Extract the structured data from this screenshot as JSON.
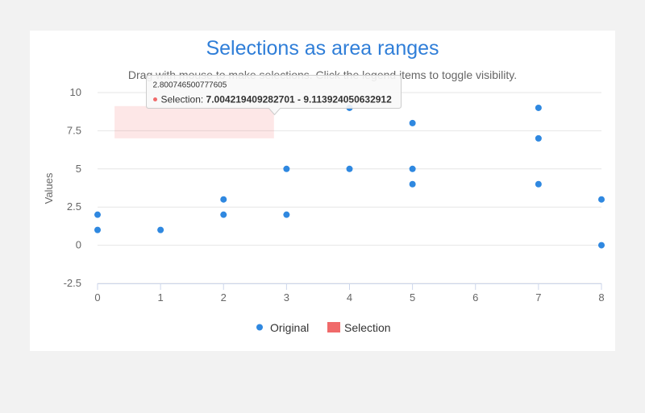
{
  "chart_data": {
    "type": "scatter",
    "title": "Selections as area ranges",
    "subtitle": "Drag with mouse to make selections. Click the legend items to toggle visibility.",
    "ylabel": "Values",
    "xlabel": "",
    "xlim": [
      0,
      8
    ],
    "ylim": [
      -2.5,
      10
    ],
    "x_ticks": [
      "0",
      "1",
      "2",
      "3",
      "4",
      "5",
      "6",
      "7",
      "8"
    ],
    "y_ticks": [
      "-2.5",
      "0",
      "2.5",
      "5",
      "7.5",
      "10"
    ],
    "grid": "horizontal",
    "legend_position": "bottom",
    "series": [
      {
        "name": "Original",
        "type": "scatter",
        "color": "#2f88e0",
        "points": [
          [
            0,
            1
          ],
          [
            0,
            2
          ],
          [
            1,
            1
          ],
          [
            2,
            2
          ],
          [
            2,
            3
          ],
          [
            3,
            2
          ],
          [
            3,
            5
          ],
          [
            4,
            5
          ],
          [
            4,
            9
          ],
          [
            5,
            4
          ],
          [
            5,
            5
          ],
          [
            5,
            8
          ],
          [
            7,
            4
          ],
          [
            7,
            7
          ],
          [
            7,
            9
          ],
          [
            8,
            0
          ],
          [
            8,
            3
          ]
        ]
      },
      {
        "name": "Selection",
        "type": "arearange",
        "color": "#f06a6a",
        "x_range": [
          0.27,
          2.800746500777605
        ],
        "low": 7.004219409282701,
        "high": 9.113924050632912
      }
    ],
    "tooltip": {
      "header": "2.800746500777605",
      "series_label": "Selection: ",
      "value": "7.004219409282701 - 9.113924050632912"
    }
  }
}
